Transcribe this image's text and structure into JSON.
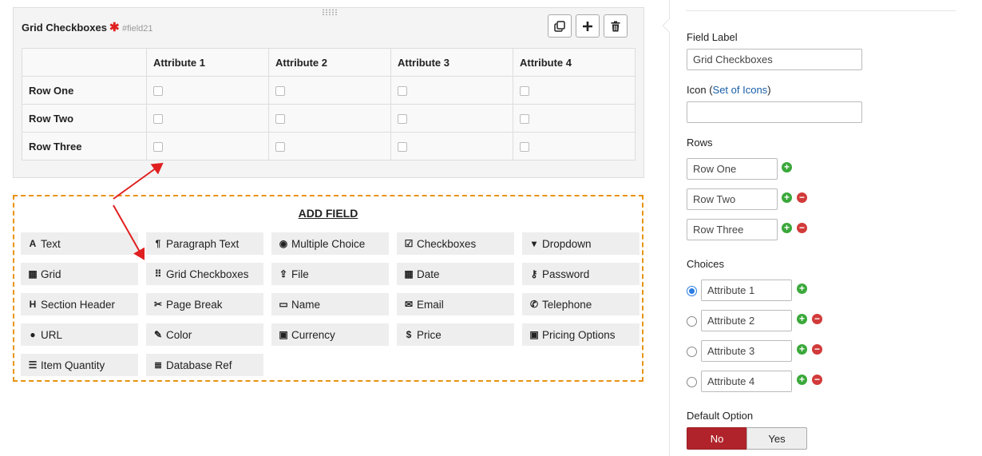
{
  "field": {
    "title": "Grid Checkboxes",
    "required_symbol": "✱",
    "id": "#field21",
    "tools": [
      "copy-icon",
      "plus-icon",
      "trash-icon"
    ]
  },
  "grid": {
    "columns": [
      "Attribute 1",
      "Attribute 2",
      "Attribute 3",
      "Attribute 4"
    ],
    "rows": [
      "Row One",
      "Row Two",
      "Row Three"
    ]
  },
  "add_field": {
    "title": "ADD FIELD",
    "types": [
      {
        "label": "Text",
        "icon": "A"
      },
      {
        "label": "Paragraph Text",
        "icon": "¶"
      },
      {
        "label": "Multiple Choice",
        "icon": "◉"
      },
      {
        "label": "Checkboxes",
        "icon": "☑"
      },
      {
        "label": "Dropdown",
        "icon": "▾"
      },
      {
        "label": "Grid",
        "icon": "▦"
      },
      {
        "label": "Grid Checkboxes",
        "icon": "⠿"
      },
      {
        "label": "File",
        "icon": "⇪"
      },
      {
        "label": "Date",
        "icon": "▦"
      },
      {
        "label": "Password",
        "icon": "⚷"
      },
      {
        "label": "Section Header",
        "icon": "H"
      },
      {
        "label": "Page Break",
        "icon": "✂"
      },
      {
        "label": "Name",
        "icon": "▭"
      },
      {
        "label": "Email",
        "icon": "✉"
      },
      {
        "label": "Telephone",
        "icon": "✆"
      },
      {
        "label": "URL",
        "icon": "●"
      },
      {
        "label": "Color",
        "icon": "✎"
      },
      {
        "label": "Currency",
        "icon": "▣"
      },
      {
        "label": "Price",
        "icon": "$"
      },
      {
        "label": "Pricing Options",
        "icon": "▣"
      },
      {
        "label": "Item Quantity",
        "icon": "☰"
      },
      {
        "label": "Database Ref",
        "icon": "≣"
      }
    ]
  },
  "settings": {
    "field_label_title": "Field Label",
    "field_label_value": "Grid Checkboxes",
    "icon_title": "Icon",
    "icon_link": "Set of Icons",
    "icon_value": "",
    "rows_title": "Rows",
    "rows": [
      "Row One",
      "Row Two",
      "Row Three"
    ],
    "choices_title": "Choices",
    "choices": [
      "Attribute 1",
      "Attribute 2",
      "Attribute 3",
      "Attribute 4"
    ],
    "selected_choice": 0,
    "default_option_title": "Default Option",
    "toggle_no": "No",
    "toggle_yes": "Yes",
    "toggle_selected": "No"
  },
  "colors": {
    "accent_orange": "#e8930c",
    "annotation_red": "#e02020",
    "toggle_active": "#b0232a",
    "add_green": "#3aa83a",
    "remove_red": "#d23a3a",
    "link_blue": "#1a5fa8"
  }
}
